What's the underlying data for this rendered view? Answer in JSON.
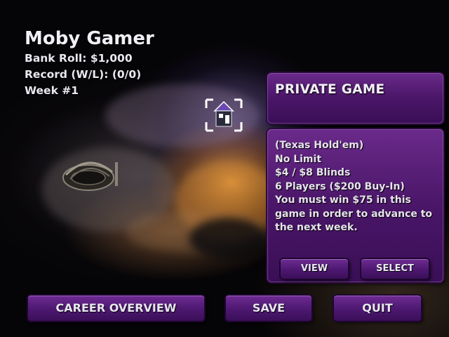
{
  "player": {
    "name": "Moby Gamer",
    "bankroll": "Bank Roll: $1,000",
    "record": "Record (W/L): (0/0)",
    "week": "Week #1"
  },
  "map": {
    "marker_icon": "poker-table-location-icon",
    "venue_icon": "stadium-icon"
  },
  "panel": {
    "title": "PRIVATE GAME",
    "details": [
      "(Texas Hold'em)",
      "No Limit",
      "$4 / $8 Blinds",
      "6 Players ($200 Buy-In)"
    ],
    "requirement": "You must win $75 in this game in order to advance to the next week.",
    "view_label": "VIEW",
    "select_label": "SELECT"
  },
  "bottom_bar": {
    "career_label": "CAREER OVERVIEW",
    "save_label": "SAVE",
    "quit_label": "QUIT"
  },
  "colors": {
    "panel_purple": "#4a1668",
    "button_purple": "#5a1e80",
    "text": "#e8e6f0"
  }
}
